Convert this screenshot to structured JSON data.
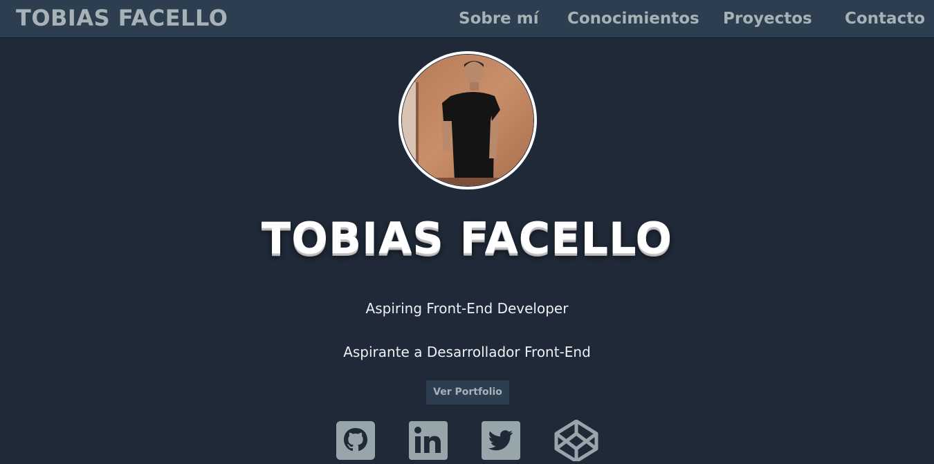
{
  "navbar": {
    "brand": "TOBIAS FACELLO",
    "items": [
      {
        "label": "Sobre mí"
      },
      {
        "label": "Conocimientos"
      },
      {
        "label": "Proyectos"
      },
      {
        "label": "Contacto"
      }
    ]
  },
  "hero": {
    "photo_alt": "Tobias Facello profile photo",
    "title": "TOBIAS FACELLO",
    "subtitle_en": "Aspiring Front-End Developer",
    "subtitle_es": "Aspirante a Desarrollador Front-End",
    "button_label": "Ver Portfolio"
  },
  "social": [
    {
      "icon": "github-icon"
    },
    {
      "icon": "linkedin-icon"
    },
    {
      "icon": "twitter-icon"
    },
    {
      "icon": "codepen-icon"
    }
  ],
  "colors": {
    "background": "#1f2937",
    "navbar": "#2d3e50",
    "nav_text": "#a7b2b6",
    "icon_fill": "#97a6ab",
    "title": "#ffffff"
  }
}
